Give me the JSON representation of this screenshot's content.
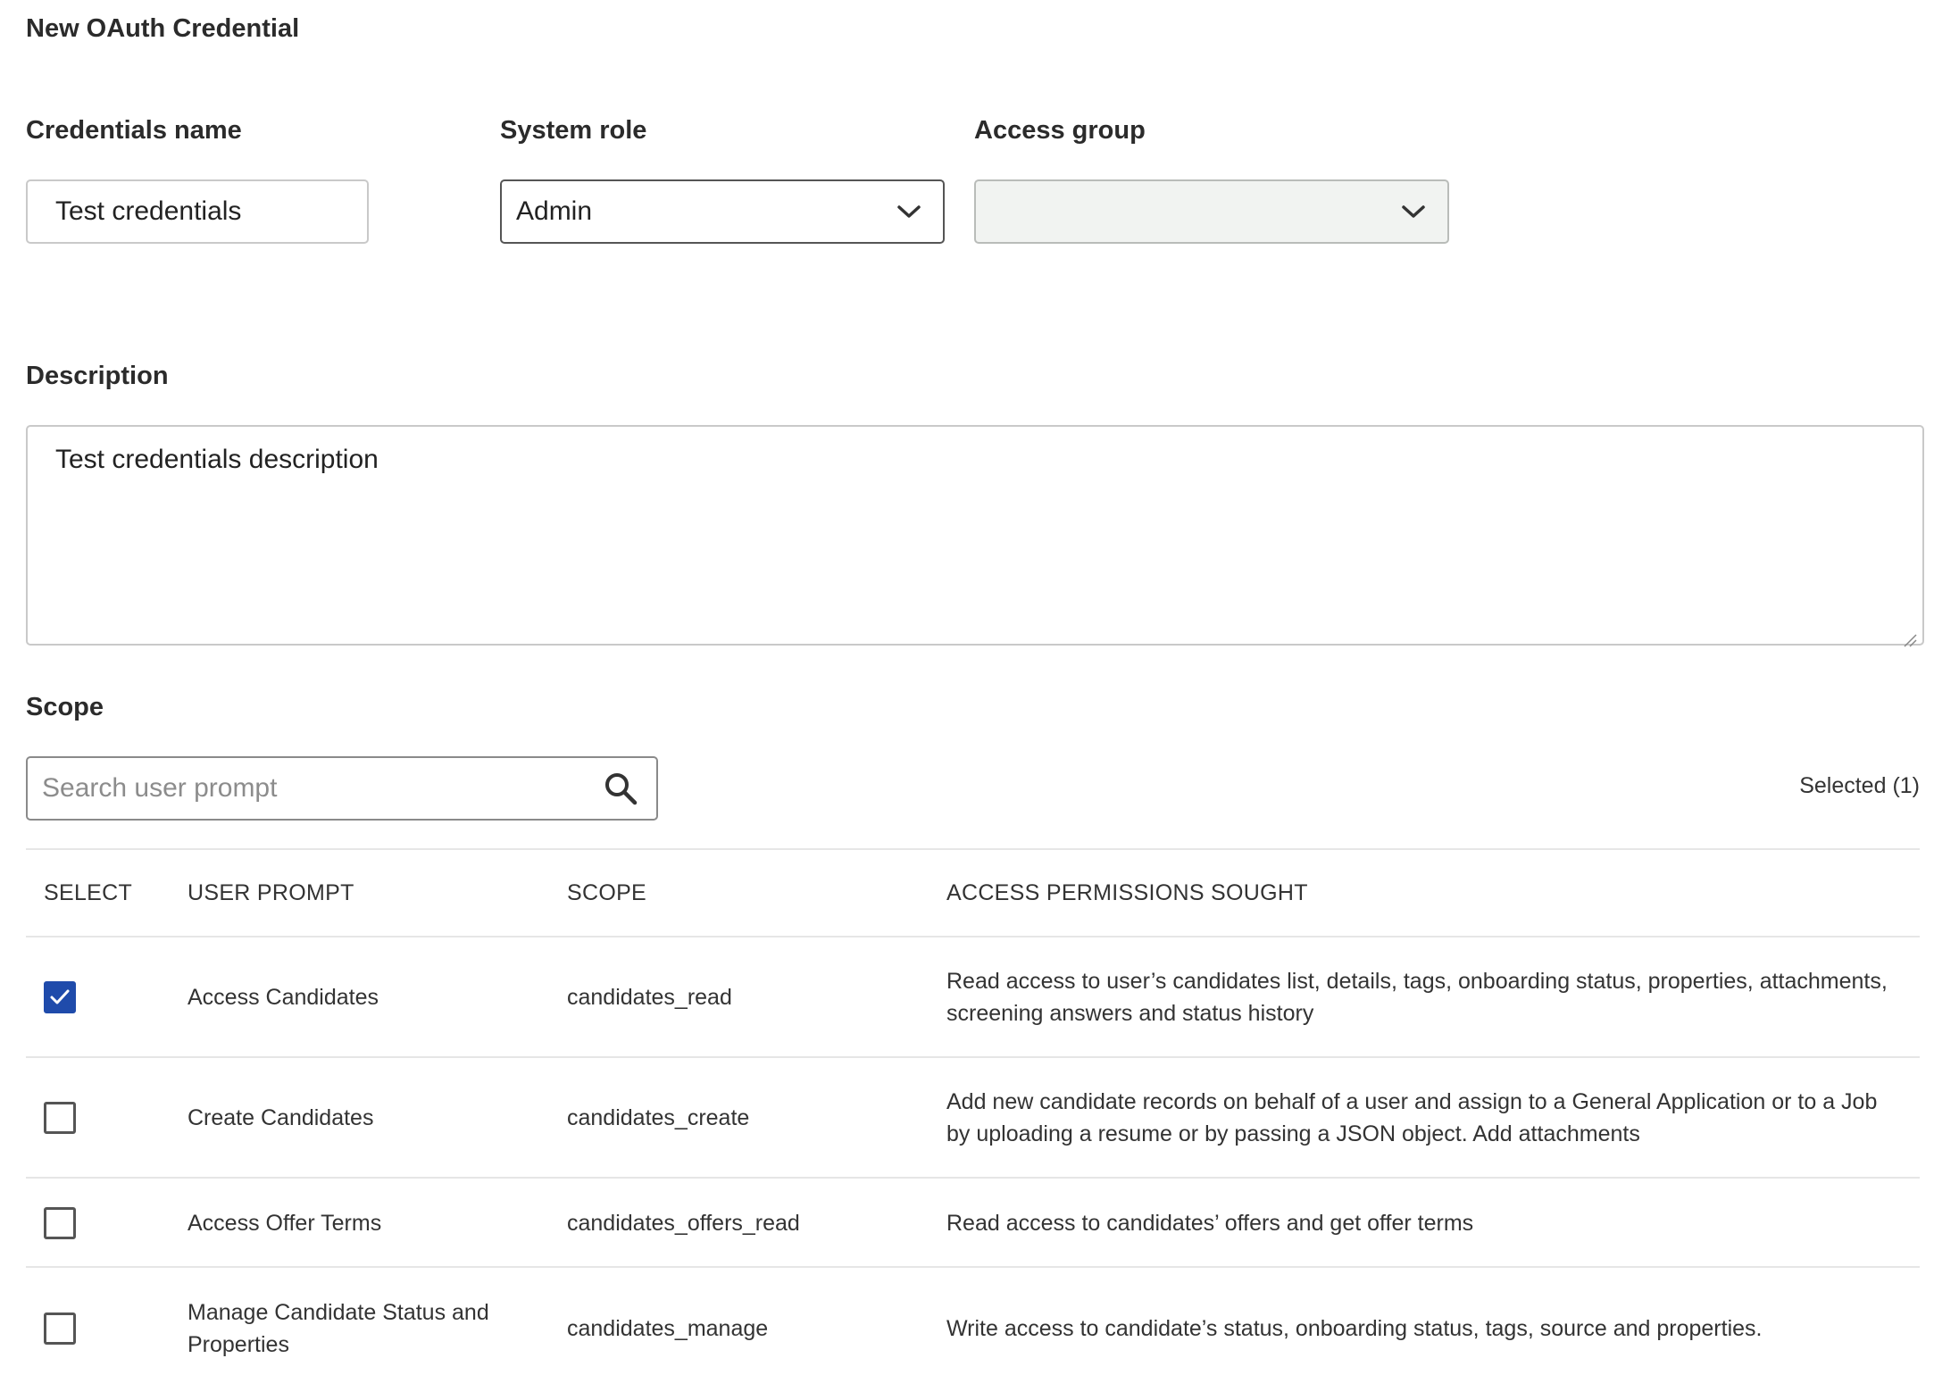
{
  "title": "New OAuth Credential",
  "form": {
    "name_label": "Credentials name",
    "name_value": "Test credentials",
    "role_label": "System role",
    "role_value": "Admin",
    "group_label": "Access group",
    "group_value": "",
    "description_label": "Description",
    "description_value": "Test credentials description"
  },
  "scope": {
    "label": "Scope",
    "search_placeholder": "Search user prompt",
    "selected_text": "Selected (1)",
    "headers": {
      "select": "SELECT",
      "prompt": "USER PROMPT",
      "scope": "SCOPE",
      "permissions": "ACCESS PERMISSIONS SOUGHT"
    },
    "rows": [
      {
        "checked": true,
        "prompt": "Access Candidates",
        "scope": "candidates_read",
        "permissions": "Read access to user’s candidates list, details, tags, onboarding status, properties, attachments, screening answers and status history"
      },
      {
        "checked": false,
        "prompt": "Create Candidates",
        "scope": "candidates_create",
        "permissions": "Add new candidate records on behalf of a user and assign to a General Application or to a Job by uploading a resume or by passing a JSON object. Add attachments"
      },
      {
        "checked": false,
        "prompt": "Access Offer Terms",
        "scope": "candidates_offers_read",
        "permissions": "Read access to candidates’ offers and get offer terms"
      },
      {
        "checked": false,
        "prompt": "Manage Candidate Status and Properties",
        "scope": "candidates_manage",
        "permissions": "Write access to candidate’s status, onboarding status, tags, source and properties."
      }
    ]
  },
  "colors": {
    "accent": "#1f4bab",
    "border": "#c9c9c9",
    "disabled_bg": "#f1f3f1"
  },
  "icons": {
    "select_chevron": "chevron-down-icon",
    "search": "search-icon",
    "check": "checkmark-icon"
  }
}
